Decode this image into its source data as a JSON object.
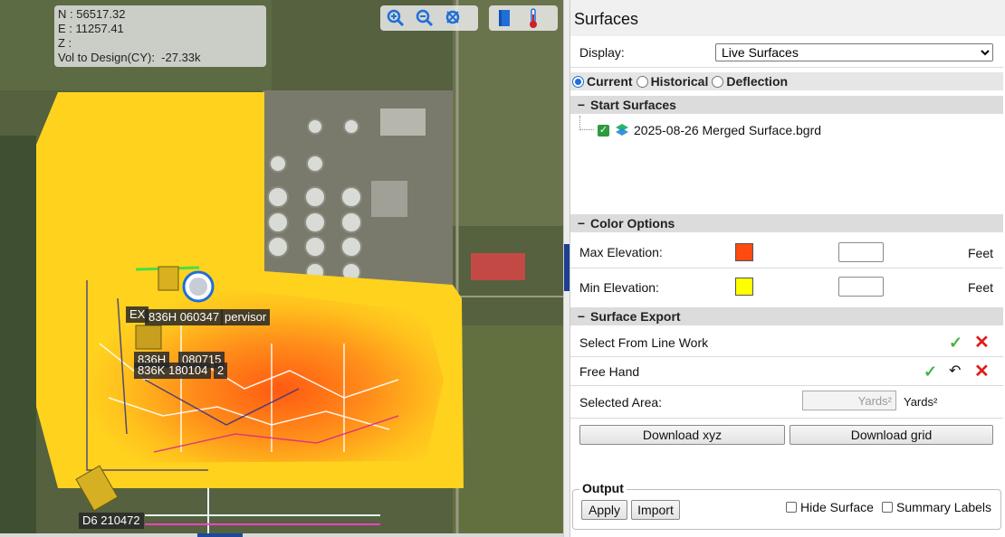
{
  "map": {
    "coords": {
      "n_label": "N :",
      "n_value": "56517.32",
      "e_label": "E :",
      "e_value": "11257.41",
      "z_label": "Z :",
      "z_value": "",
      "vol_label": "Vol to Design(CY):",
      "vol_value": "-27.33k"
    },
    "tools": [
      "zoom-in-icon",
      "zoom-out-icon",
      "zoom-extents-icon",
      "book-icon",
      "thermometer-icon"
    ],
    "machines": [
      {
        "label": "EX",
        "name": "machine-ex"
      },
      {
        "label": "836H 060347",
        "name": "machine-836h-060347"
      },
      {
        "label": "pervisor",
        "name": "machine-supervisor"
      },
      {
        "label": "836H",
        "name": "machine-836h"
      },
      {
        "label": "080715",
        "name": "machine-080715"
      },
      {
        "label": "836K 180104",
        "name": "machine-836k-180104"
      },
      {
        "label": "2",
        "name": "machine-2"
      },
      {
        "label": "D6 210472",
        "name": "machine-d6-210472"
      }
    ]
  },
  "panel": {
    "title": "Surfaces",
    "display_label": "Display:",
    "display_value": "Live Surfaces",
    "display_options": [
      "Live Surfaces"
    ],
    "modes": [
      {
        "label": "Current",
        "selected": true
      },
      {
        "label": "Historical",
        "selected": false
      },
      {
        "label": "Deflection",
        "selected": false
      }
    ],
    "start_surfaces": {
      "heading": "Start Surfaces",
      "items": [
        {
          "label": "2025-08-26 Merged Surface.bgrd",
          "checked": true
        }
      ]
    },
    "color_options": {
      "heading": "Color Options",
      "max_label": "Max Elevation:",
      "max_color": "#ff4a10",
      "max_value": "",
      "max_unit": "Feet",
      "min_label": "Min Elevation:",
      "min_color": "#ffff00",
      "min_value": "",
      "min_unit": "Feet"
    },
    "surface_export": {
      "heading": "Surface Export",
      "select_label": "Select From Line Work",
      "freehand_label": "Free Hand",
      "area_label": "Selected Area:",
      "area_placeholder": "Yards²",
      "area_unit": "Yards²",
      "download_xyz": "Download xyz",
      "download_grid": "Download grid"
    },
    "output": {
      "legend": "Output",
      "apply": "Apply",
      "import": "Import",
      "hide_surface": "Hide Surface",
      "summary_labels": "Summary Labels"
    }
  },
  "colors": {
    "accent": "#1d3f8f",
    "check_green": "#43b343",
    "cancel_red": "#e01b1b",
    "surface_high": "#ff4a10",
    "surface_low": "#ffd400"
  }
}
